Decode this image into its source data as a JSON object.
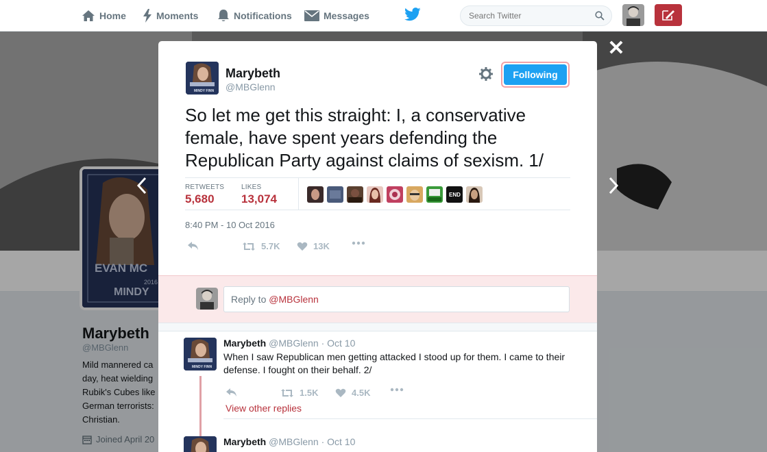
{
  "nav": {
    "home": "Home",
    "moments": "Moments",
    "notifications": "Notifications",
    "messages": "Messages",
    "search_placeholder": "Search Twitter"
  },
  "profile": {
    "name": "Marybeth",
    "handle": "@MBGlenn",
    "bio": [
      "Mild mannered ca",
      "day, heat wielding",
      "Rubik's Cubes like",
      "German terrorists:",
      "Christian."
    ],
    "joined": "Joined April 20",
    "avatar_text_top": "EVAN MC",
    "avatar_text_year": "2016",
    "avatar_text_bottom": "MINDY"
  },
  "modal": {
    "close": "✕",
    "author": {
      "name": "Marybeth",
      "handle": "@MBGlenn",
      "avatar_caption": "MINDY FINN"
    },
    "follow_button": "Following",
    "tweet_text": "So let me get this straight: I, a conservative female, have spent years defending the Republican Party against claims of sexism. 1/",
    "stats": {
      "retweets_label": "RETWEETS",
      "retweets_value": "5,680",
      "likes_label": "LIKES",
      "likes_value": "13,074"
    },
    "likers": [
      "liker-1",
      "liker-2",
      "liker-3",
      "liker-4",
      "liker-5",
      "liker-6",
      "liker-7",
      "liker-8",
      "liker-9"
    ],
    "liker_8_text": "END",
    "timestamp": "8:40 PM - 10 Oct 2016",
    "actions": {
      "retweet_count": "5.7K",
      "like_count": "13K"
    },
    "reply": {
      "prefix": "Reply to ",
      "mention": "@MBGlenn"
    },
    "replies": [
      {
        "name": "Marybeth",
        "meta": "@MBGlenn · Oct 10",
        "text": "When I saw Republican men getting attacked I stood up for them. I came to their defense. I fought on their behalf. 2/",
        "retweet_count": "1.5K",
        "like_count": "4.5K"
      },
      {
        "name": "Marybeth",
        "meta": "@MBGlenn · Oct 10",
        "text": "",
        "retweet_count": "",
        "like_count": ""
      }
    ],
    "view_other_replies": "View other replies"
  },
  "colors": {
    "accent": "#1da1f2",
    "brand_red": "#b8323c",
    "reply_bg": "#fbe9ea"
  }
}
